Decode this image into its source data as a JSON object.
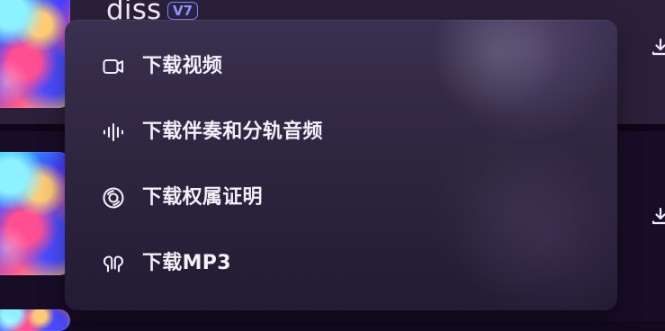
{
  "track_top": {
    "title": "diss",
    "version": "V7"
  },
  "menu": {
    "items": [
      {
        "label": "下载视频",
        "icon": "video-icon"
      },
      {
        "label": "下载伴奏和分轨音频",
        "icon": "audio-waveform-icon"
      },
      {
        "label": "下载权属证明",
        "icon": "disc-icon"
      },
      {
        "label": "下载MP3",
        "icon": "earbuds-icon"
      }
    ]
  },
  "icons": {
    "download": "download-icon"
  },
  "colors": {
    "menu_background": "#2e253f",
    "badge_accent": "#8f98ff",
    "text_primary": "#f3f0f8"
  }
}
